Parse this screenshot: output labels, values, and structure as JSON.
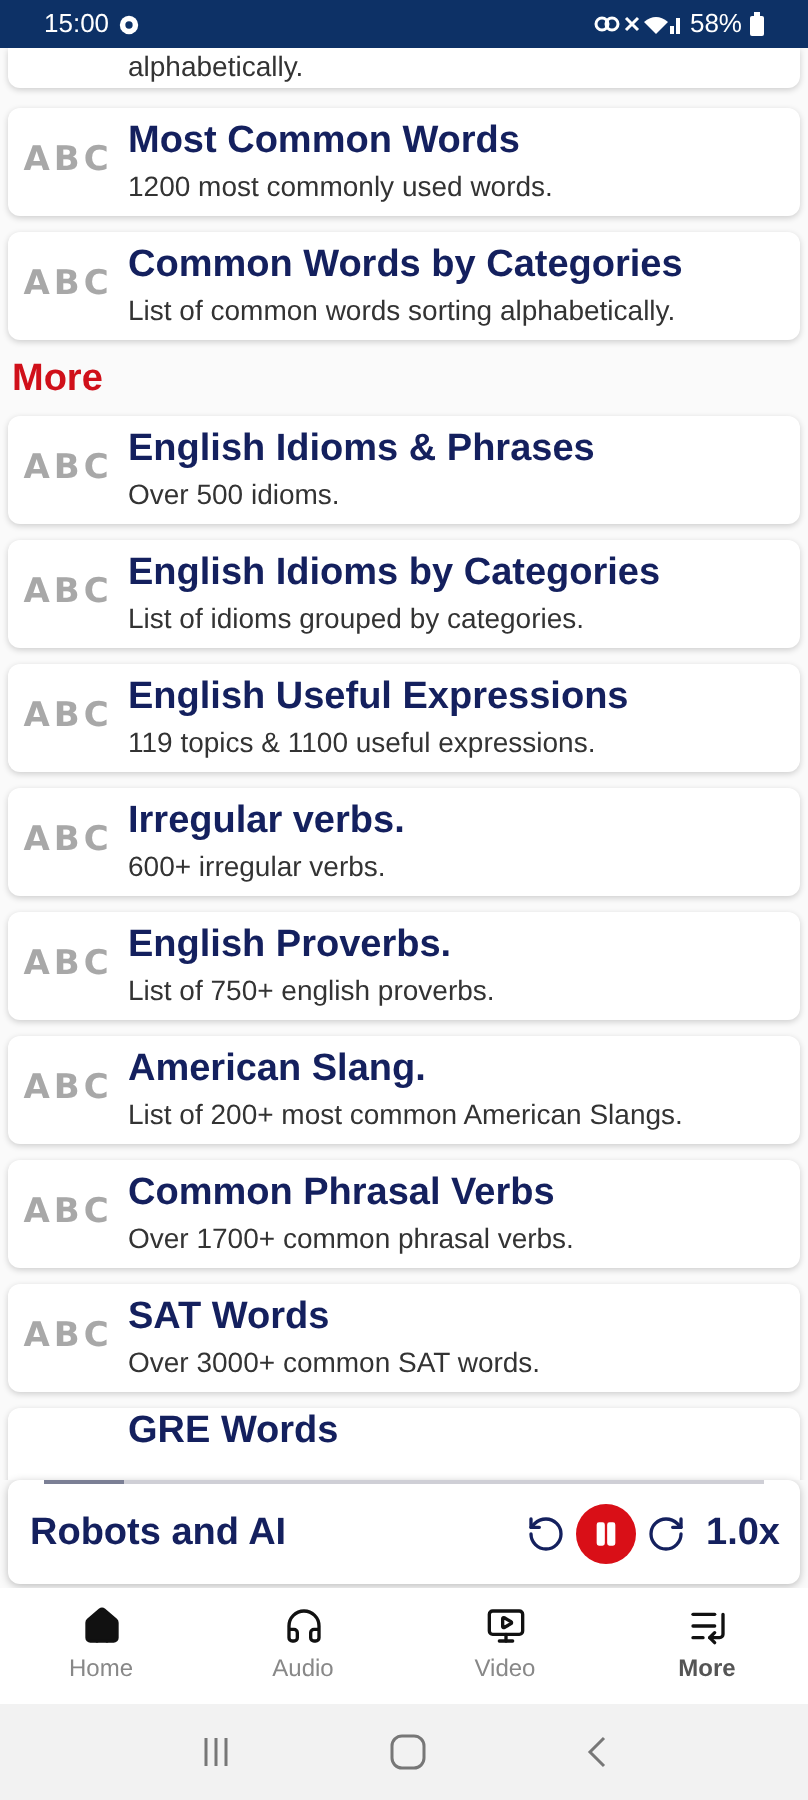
{
  "status_bar": {
    "time": "15:00",
    "battery": "58%"
  },
  "partial_top_item": {
    "description": "alphabetically."
  },
  "sections": [
    {
      "items": [
        {
          "icon_text": "ABC",
          "title": "Most Common Words",
          "description": "1200 most commonly used words."
        },
        {
          "icon_text": "ABC",
          "title": "Common Words by Categories",
          "description": "List of common words sorting alphabetically."
        }
      ]
    },
    {
      "heading": "More",
      "items": [
        {
          "icon_text": "ABC",
          "title": "English Idioms & Phrases",
          "description": "Over 500 idioms."
        },
        {
          "icon_text": "ABC",
          "title": "English Idioms by Categories",
          "description": "List of idioms grouped by categories."
        },
        {
          "icon_text": "ABC",
          "title": "English Useful Expressions",
          "description": "119 topics & 1100 useful expressions."
        },
        {
          "icon_text": "ABC",
          "title": "Irregular verbs.",
          "description": "600+ irregular verbs."
        },
        {
          "icon_text": "ABC",
          "title": "English Proverbs.",
          "description": "List of 750+ english proverbs."
        },
        {
          "icon_text": "ABC",
          "title": "American Slang.",
          "description": "List of 200+ most common American Slangs."
        },
        {
          "icon_text": "ABC",
          "title": "Common Phrasal Verbs",
          "description": "Over 1700+ common phrasal verbs."
        },
        {
          "icon_text": "ABC",
          "title": "SAT Words",
          "description": "Over 3000+ common SAT words."
        }
      ]
    }
  ],
  "partial_bottom_item": {
    "title": "GRE Words"
  },
  "player": {
    "title": "Robots and AI",
    "level": 0.11,
    "playing": true,
    "speed": "1.0x"
  },
  "bottom_nav": [
    {
      "kind": "home",
      "label": "Home",
      "selected": false
    },
    {
      "kind": "audio",
      "label": "Audio",
      "selected": false
    },
    {
      "kind": "video",
      "label": "Video",
      "selected": false
    },
    {
      "kind": "more",
      "label": "More",
      "selected": true
    }
  ]
}
